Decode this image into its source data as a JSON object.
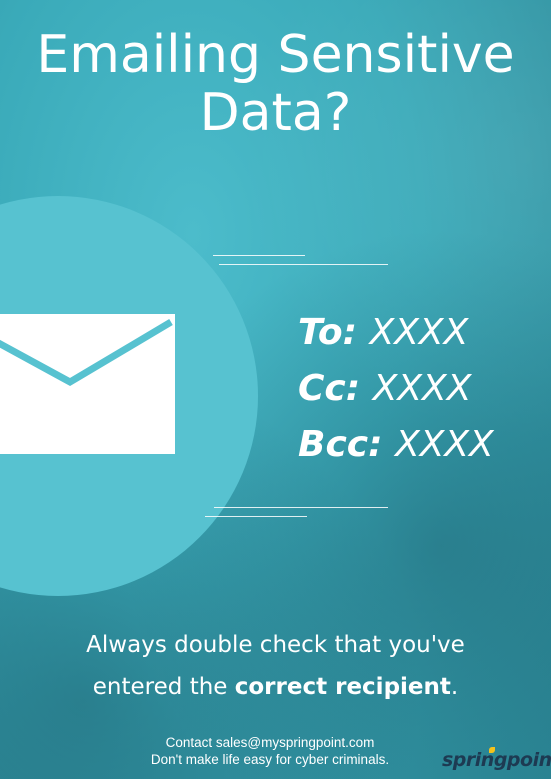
{
  "title": {
    "line1": "Emailing Sensitive",
    "line2": "Data?"
  },
  "recipients": {
    "to_label": "To:",
    "to_value": "XXXX",
    "cc_label": "Cc:",
    "cc_value": "XXXX",
    "bcc_label": "Bcc:",
    "bcc_value": "XXXX"
  },
  "message": {
    "line1": "Always double check that you've",
    "line2_prefix": "entered the ",
    "line2_bold": "correct recipient",
    "line2_suffix": "."
  },
  "footer": {
    "contact": "Contact sales@myspringpoint.com",
    "tagline": "Don't make life easy for cyber criminals."
  },
  "logo": {
    "text": "springpoint"
  },
  "colors": {
    "background": "#3aaab9",
    "circle": "#57c2d0",
    "text": "#ffffff",
    "logo": "#1d3a52",
    "logo_accent": "#f5c21b"
  },
  "icons": [
    "envelope-icon"
  ]
}
